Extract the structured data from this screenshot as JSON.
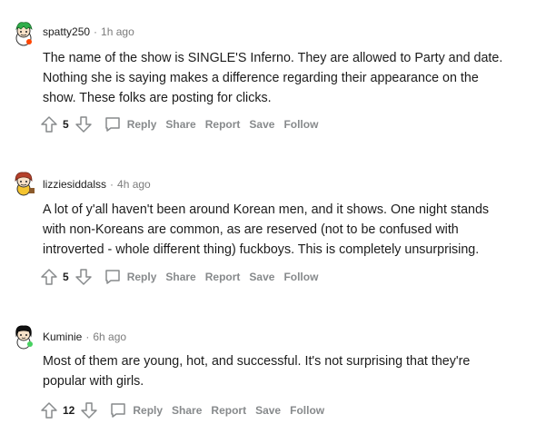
{
  "comments": [
    {
      "username": "spatty250",
      "separator": "·",
      "time": "1h ago",
      "avatar_icon": "snoo-green-hair-avatar-icon",
      "lines": [
        "The name of the show is SINGLE'S Inferno. They are allowed to Party and date.",
        "Nothing she is saying makes a difference regarding their appearance on the",
        "show. These folks are posting for clicks."
      ],
      "score": "5",
      "actions": [
        "Reply",
        "Share",
        "Report",
        "Save",
        "Follow"
      ]
    },
    {
      "username": "lizziesiddalss",
      "separator": "·",
      "time": "4h ago",
      "avatar_icon": "snoo-red-hair-avatar-icon",
      "lines": [
        "A lot of y'all haven't been around Korean men, and it shows. One night stands",
        "with non-Koreans are common, as are reserved (not to be confused with",
        "introverted - whole different thing) fuckboys. This is completely unsurprising."
      ],
      "score": "5",
      "actions": [
        "Reply",
        "Share",
        "Report",
        "Save",
        "Follow"
      ]
    },
    {
      "username": "Kuminie",
      "separator": "·",
      "time": "6h ago",
      "avatar_icon": "snoo-black-hair-avatar-icon",
      "lines": [
        "Most of them are young, hot, and successful. It's not surprising that they're",
        "popular with girls."
      ],
      "score": "12",
      "actions": [
        "Reply",
        "Share",
        "Report",
        "Save",
        "Follow"
      ]
    }
  ],
  "colors": {
    "text": "#1c1c1c",
    "meta": "#7c7c7c",
    "action": "#878a8c"
  }
}
